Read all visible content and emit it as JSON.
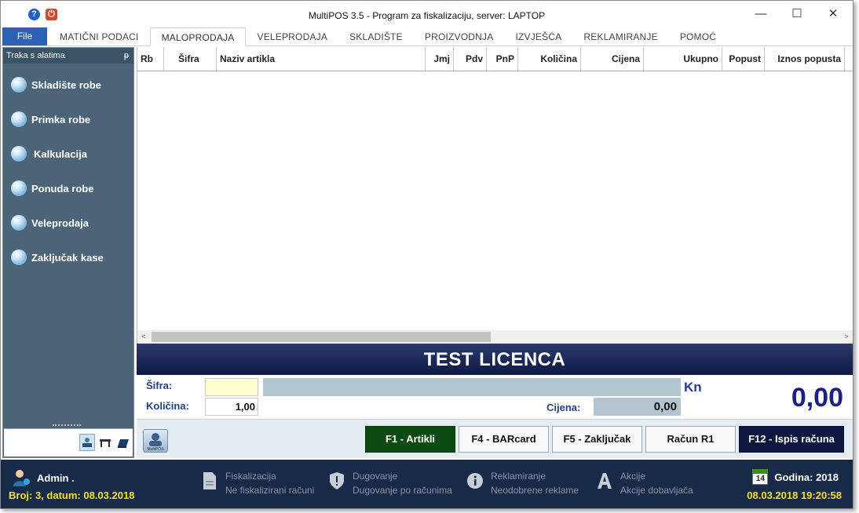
{
  "window": {
    "title": "MultiPOS 3.5 - Program za fiskalizaciju, server: LAPTOP",
    "controls": {
      "minimize": "—",
      "maximize": "☐",
      "close": "✕"
    },
    "help_glyph": "?",
    "power_glyph": "⏻"
  },
  "menu": {
    "file": "File",
    "tabs": [
      "MATIČNI PODACI",
      "MALOPRODAJA",
      "VELEPRODAJA",
      "SKLADIŠTE",
      "PROIZVODNJA",
      "IZVJEŠĆA",
      "REKLAMIRANJE",
      "POMOĆ"
    ],
    "active_tab": "MALOPRODAJA"
  },
  "sidebar": {
    "title": "Traka s alatima",
    "pin_glyph": "ᵽ",
    "items": [
      "Skladište robe",
      "Primka robe",
      "Kalkulacija",
      "Ponuda robe",
      "Veleprodaja",
      "Zaključak kase"
    ]
  },
  "grid": {
    "columns": [
      "Rb",
      "Šifra",
      "Naziv artikla",
      "Jmj",
      "Pdv",
      "PnP",
      "Količina",
      "Cijena",
      "Ukupno",
      "Popust",
      "Iznos popusta"
    ],
    "rows": [],
    "scroll_left": "<",
    "scroll_right": ">"
  },
  "banner": {
    "text": "TEST LICENCA"
  },
  "entry": {
    "sifra_label": "Šifra:",
    "kolicina_label": "Količina:",
    "kolicina_value": "1,00",
    "cijena_label": "Cijena:",
    "cijena_value": "0,00",
    "currency": "Kn",
    "total": "0,00"
  },
  "buttons": {
    "f1": "F1 - Artikli",
    "f4": "F4 - BARcard",
    "f5": "F5 - Zaključak",
    "r1": "Račun R1",
    "f12": "F12 - Ispis računa",
    "logo_text": "MultiPOS"
  },
  "status": {
    "user": "Admin .",
    "receipt": "Broj: 3, datum: 08.03.2018",
    "fiskalizacija_title": "Fiskalizacija",
    "fiskalizacija_sub": "Ne fiskalizirani računi",
    "dugovanje_title": "Dugovanje",
    "dugovanje_sub": "Dugovanje po računima",
    "reklamiranje_title": "Reklamiranje",
    "reklamiranje_sub": "Neodobrene reklame",
    "akcije_title": "Akcije",
    "akcije_sub": "Akcije dobavljača",
    "calendar_day": "14",
    "year": "Godina: 2018",
    "datetime": "08.03.2018 19:20:58"
  },
  "colors": {
    "accent": "#2b62b8",
    "sidebar": "#4b6478",
    "banner": "#0e1a46",
    "status_bg": "#172a48",
    "status_highlight": "#f2e21a",
    "total_text": "#1b1f8c"
  }
}
